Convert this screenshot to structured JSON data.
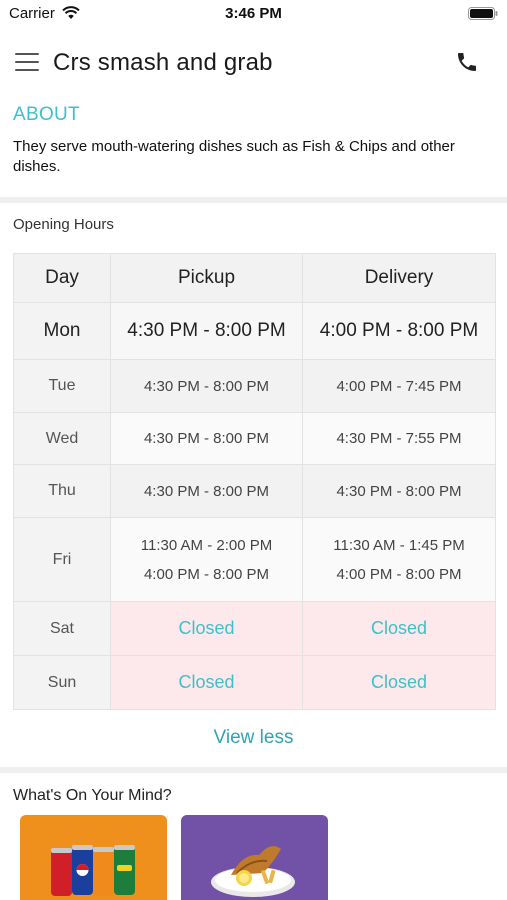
{
  "status_bar": {
    "carrier": "Carrier",
    "time": "3:46 PM"
  },
  "header": {
    "title": "Crs smash and grab"
  },
  "about": {
    "heading": "ABOUT",
    "text": "They serve mouth-watering dishes such as Fish & Chips and other dishes."
  },
  "hours": {
    "label": "Opening Hours",
    "columns": [
      "Day",
      "Pickup",
      "Delivery"
    ],
    "rows": [
      {
        "day": "Mon",
        "pickup": [
          "4:30 PM - 8:00 PM"
        ],
        "delivery": [
          "4:00 PM - 8:00 PM"
        ]
      },
      {
        "day": "Tue",
        "pickup": [
          "4:30 PM - 8:00 PM"
        ],
        "delivery": [
          "4:00 PM - 7:45 PM"
        ]
      },
      {
        "day": "Wed",
        "pickup": [
          "4:30 PM - 8:00 PM"
        ],
        "delivery": [
          "4:30 PM - 7:55 PM"
        ]
      },
      {
        "day": "Thu",
        "pickup": [
          "4:30 PM - 8:00 PM"
        ],
        "delivery": [
          "4:30 PM - 8:00 PM"
        ]
      },
      {
        "day": "Fri",
        "pickup": [
          "11:30 AM - 2:00 PM",
          "4:00 PM - 8:00 PM"
        ],
        "delivery": [
          "11:30 AM - 1:45 PM",
          "4:00 PM - 8:00 PM"
        ]
      },
      {
        "day": "Sat",
        "pickup": "Closed",
        "delivery": "Closed"
      },
      {
        "day": "Sun",
        "pickup": "Closed",
        "delivery": "Closed"
      }
    ],
    "view_toggle": "View less"
  },
  "mind": {
    "label": "What's On Your Mind?"
  },
  "colors": {
    "accent": "#3fc0c9",
    "closed_bg": "#fde9eb",
    "drinks_card": "#ef8f1c",
    "fish_card": "#7252a6"
  },
  "icons": [
    "wifi-icon",
    "battery-icon",
    "menu-icon",
    "phone-icon"
  ]
}
